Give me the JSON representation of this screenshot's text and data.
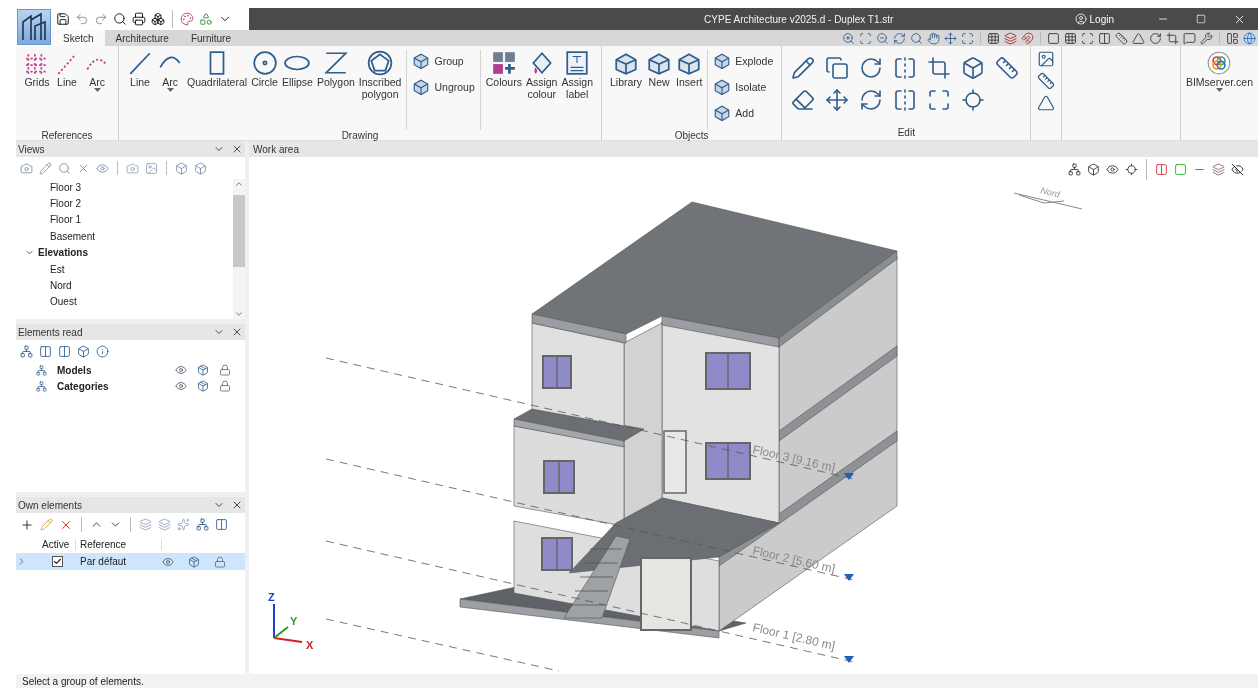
{
  "window": {
    "title": "CYPE Architecture v2025.d - Duplex T1.str",
    "login": "Login"
  },
  "tabs": [
    {
      "label": "Sketch",
      "selected": true
    },
    {
      "label": "Architecture",
      "selected": false
    },
    {
      "label": "Furniture",
      "selected": false
    }
  ],
  "ribbon": [
    {
      "label": "References",
      "sections": [
        [
          {
            "label": "Grids",
            "kind": "large"
          },
          {
            "label": "Line",
            "kind": "large"
          },
          {
            "label": "Arc",
            "kind": "large",
            "dropdown": true
          }
        ]
      ]
    },
    {
      "label": "Drawing",
      "sections": [
        [
          {
            "label": "Line",
            "kind": "large"
          },
          {
            "label": "Arc",
            "kind": "large",
            "dropdown": true
          },
          {
            "label": "Quadrilateral",
            "kind": "large"
          },
          {
            "label": "Circle",
            "kind": "large"
          },
          {
            "label": "Ellipse",
            "kind": "large"
          },
          {
            "label": "Polygon",
            "kind": "large"
          },
          {
            "label": "Inscribed polygon",
            "kind": "large"
          }
        ],
        [
          {
            "label": "Group",
            "kind": "small"
          },
          {
            "label": "Ungroup",
            "kind": "small"
          }
        ],
        [
          {
            "label": "Colours",
            "kind": "large"
          },
          {
            "label": "Assign colour",
            "kind": "large"
          },
          {
            "label": "Assign label",
            "kind": "large"
          }
        ]
      ]
    },
    {
      "label": "Objects",
      "sections": [
        [
          {
            "label": "Library",
            "kind": "large"
          },
          {
            "label": "New",
            "kind": "large"
          },
          {
            "label": "Insert",
            "kind": "large"
          }
        ],
        [
          {
            "label": "Explode",
            "kind": "small"
          },
          {
            "label": "Isolate",
            "kind": "small"
          },
          {
            "label": "Add",
            "kind": "small"
          }
        ]
      ]
    },
    {
      "label": "Edit"
    }
  ],
  "bimserver": {
    "label": "BIMserver.cen"
  },
  "views_panel": {
    "title": "Views",
    "tree": [
      {
        "children": [
          {
            "label": "Floor 3"
          },
          {
            "label": "Floor 2"
          },
          {
            "label": "Floor 1"
          },
          {
            "label": "Basement"
          }
        ]
      },
      {
        "label": "Elevations",
        "expanded": true,
        "children": [
          {
            "label": "Est"
          },
          {
            "label": "Nord"
          },
          {
            "label": "Ouest"
          }
        ]
      }
    ]
  },
  "elements_read": {
    "title": "Elements read",
    "items": [
      {
        "label": "Models"
      },
      {
        "label": "Categories"
      }
    ]
  },
  "own_elements": {
    "title": "Own elements",
    "columns": [
      "Active",
      "Reference"
    ],
    "rows": [
      {
        "active": true,
        "reference": "Par défaut",
        "selected": true
      }
    ]
  },
  "work_area": {
    "title": "Work area",
    "compass": "Nord",
    "levels": [
      {
        "label": "Floor 3 [9.16 m]"
      },
      {
        "label": "Floor 2 [5.60 m]"
      },
      {
        "label": "Floor 1 [2.80 m]"
      }
    ],
    "axes": [
      "Z",
      "Y",
      "X"
    ]
  },
  "status_bar": "Select a group of elements."
}
